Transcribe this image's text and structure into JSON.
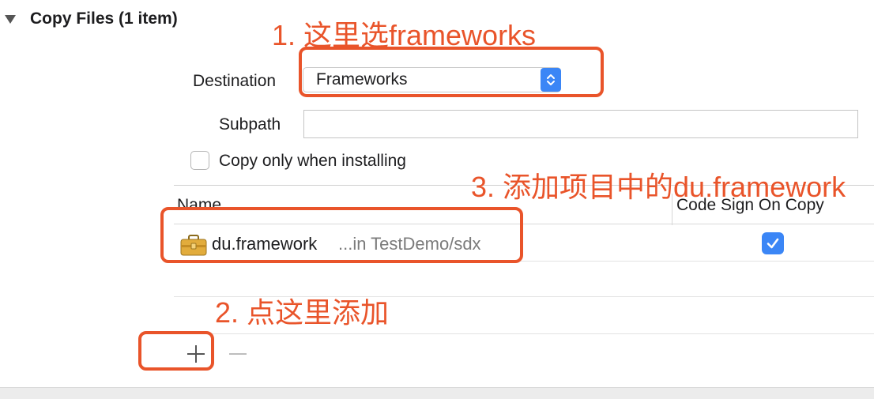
{
  "section": {
    "title": "Copy Files (1 item)"
  },
  "form": {
    "destination_label": "Destination",
    "destination_value": "Frameworks",
    "subpath_label": "Subpath",
    "subpath_value": "",
    "copy_only_label": "Copy only when installing",
    "copy_only_checked": false
  },
  "table": {
    "columns": [
      "Name",
      "Code Sign On Copy"
    ],
    "rows": [
      {
        "name": "du.framework",
        "location": "...in TestDemo/sdx",
        "code_sign": true,
        "icon": "framework-briefcase-icon"
      }
    ]
  },
  "toolbar": {
    "add_label": "+",
    "remove_label": "—"
  },
  "annotations": {
    "step1": "1. 这里选frameworks",
    "step2": "2. 点这里添加",
    "step3": "3. 添加项目中的du.framework",
    "color": "#e9542a"
  },
  "colors": {
    "accent": "#3b86f6"
  }
}
